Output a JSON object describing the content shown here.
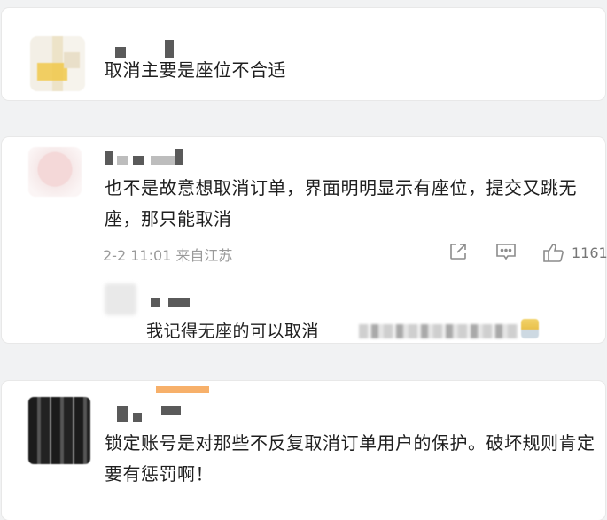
{
  "comments": [
    {
      "text": "取消主要是座位不合适"
    },
    {
      "text": "也不是故意想取消订单，界面明明显示有座位，提交又跳无座，那只能取消",
      "meta": "2-2 11:01 来自江苏",
      "like_count": "1161",
      "reply": {
        "text": "我记得无座的可以取消"
      }
    },
    {
      "text": "锁定账号是对那些不反复取消订单用户的保护。破坏规则肯定要有惩罚啊！"
    }
  ],
  "icons": {
    "share": "share-icon",
    "comment": "comment-icon",
    "like": "thumbs-up-icon"
  }
}
